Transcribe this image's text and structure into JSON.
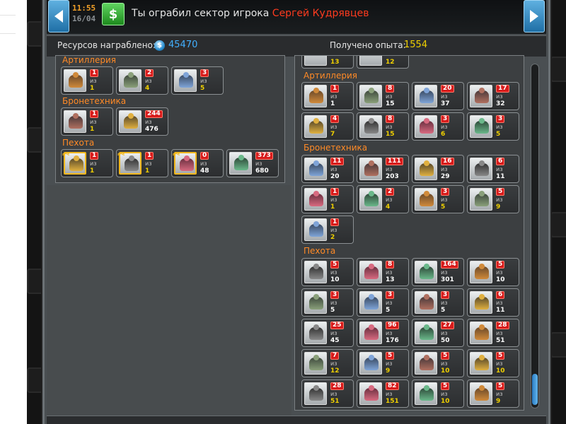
{
  "header": {
    "time": "11:55",
    "date": "16/04",
    "message_prefix": "Ты ограбил сектор игрока",
    "player_name": "Сергей Кудрявцев",
    "dollar_symbol": "$"
  },
  "stats": {
    "resources_label": "Ресурсов награблено:",
    "resources_value": "45470",
    "coin_symbol": "$",
    "experience_label": "Получено опыта:",
    "experience_value": "1554"
  },
  "colors": {
    "accent_orange": "#ff8a26",
    "name_red": "#ff3b1f",
    "resource_blue": "#42b0ff",
    "exp_yellow": "#f0d000",
    "badge_red": "#d81b1b"
  },
  "left_panel": {
    "artillery": {
      "title": "Артиллерия",
      "cards": [
        {
          "lost": "1",
          "of": "из",
          "total": "1",
          "icon": "artillery-unit-icon"
        },
        {
          "lost": "2",
          "of": "из",
          "total": "4",
          "icon": "artillery-unit-icon"
        },
        {
          "lost": "3",
          "of": "из",
          "total": "5",
          "icon": "artillery-unit-icon"
        }
      ]
    },
    "armor": {
      "title": "Бронетехника",
      "cards": [
        {
          "lost": "1",
          "of": "из",
          "total": "1",
          "icon": "tank-unit-icon"
        },
        {
          "lost": "244",
          "of": "из",
          "total": "476",
          "icon": "tank-unit-icon"
        }
      ]
    },
    "infantry": {
      "title": "Пехота",
      "cards": [
        {
          "lost": "1",
          "of": "из",
          "total": "1",
          "icon": "soldier-unit-icon"
        },
        {
          "lost": "1",
          "of": "из",
          "total": "1",
          "icon": "soldier-unit-icon"
        },
        {
          "lost": "0",
          "of": "из",
          "total": "48",
          "icon": "soldier-unit-icon"
        },
        {
          "lost": "373",
          "of": "из",
          "total": "680",
          "icon": "soldier-unit-icon"
        }
      ]
    }
  },
  "right_panel": {
    "top_partial": [
      "13",
      "12"
    ],
    "artillery": {
      "title": "Артиллерия",
      "cards": [
        {
          "lost": "1",
          "of": "из",
          "total": "1"
        },
        {
          "lost": "8",
          "of": "из",
          "total": "15"
        },
        {
          "lost": "20",
          "of": "из",
          "total": "37"
        },
        {
          "lost": "17",
          "of": "из",
          "total": "32"
        },
        {
          "lost": "4",
          "of": "из",
          "total": "7"
        },
        {
          "lost": "8",
          "of": "из",
          "total": "15"
        },
        {
          "lost": "3",
          "of": "из",
          "total": "6"
        },
        {
          "lost": "3",
          "of": "из",
          "total": "5"
        }
      ]
    },
    "armor": {
      "title": "Бронетехника",
      "cards": [
        {
          "lost": "11",
          "of": "из",
          "total": "20"
        },
        {
          "lost": "111",
          "of": "из",
          "total": "203"
        },
        {
          "lost": "16",
          "of": "из",
          "total": "29"
        },
        {
          "lost": "6",
          "of": "из",
          "total": "11"
        },
        {
          "lost": "1",
          "of": "из",
          "total": "1"
        },
        {
          "lost": "2",
          "of": "из",
          "total": "4"
        },
        {
          "lost": "3",
          "of": "из",
          "total": "5"
        },
        {
          "lost": "5",
          "of": "из",
          "total": "9"
        },
        {
          "lost": "1",
          "of": "из",
          "total": "2"
        }
      ]
    },
    "infantry": {
      "title": "Пехота",
      "cards": [
        {
          "lost": "5",
          "of": "из",
          "total": "10"
        },
        {
          "lost": "8",
          "of": "из",
          "total": "13"
        },
        {
          "lost": "164",
          "of": "из",
          "total": "301"
        },
        {
          "lost": "5",
          "of": "из",
          "total": "10"
        },
        {
          "lost": "3",
          "of": "из",
          "total": "5"
        },
        {
          "lost": "3",
          "of": "из",
          "total": "5"
        },
        {
          "lost": "3",
          "of": "из",
          "total": "5"
        },
        {
          "lost": "6",
          "of": "из",
          "total": "11"
        },
        {
          "lost": "25",
          "of": "из",
          "total": "45"
        },
        {
          "lost": "96",
          "of": "из",
          "total": "176"
        },
        {
          "lost": "27",
          "of": "из",
          "total": "50"
        },
        {
          "lost": "28",
          "of": "из",
          "total": "51"
        },
        {
          "lost": "7",
          "of": "из",
          "total": "12"
        },
        {
          "lost": "5",
          "of": "из",
          "total": "9"
        },
        {
          "lost": "5",
          "of": "из",
          "total": "10"
        },
        {
          "lost": "5",
          "of": "из",
          "total": "10"
        },
        {
          "lost": "28",
          "of": "из",
          "total": "51"
        },
        {
          "lost": "82",
          "of": "из",
          "total": "151"
        },
        {
          "lost": "5",
          "of": "из",
          "total": "10"
        },
        {
          "lost": "5",
          "of": "из",
          "total": "9"
        }
      ]
    }
  }
}
